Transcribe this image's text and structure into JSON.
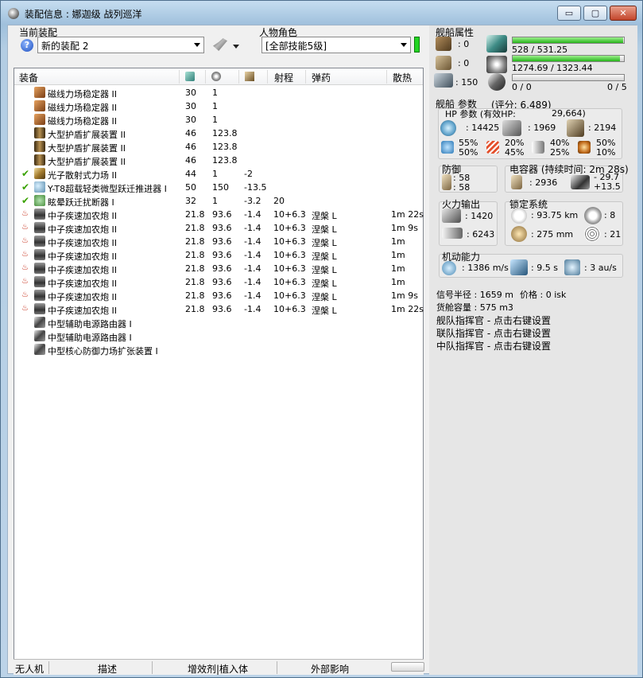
{
  "window": {
    "title": "装配信息 : 娜迦级 战列巡洋",
    "minimize_label": "▭",
    "maximize_label": "▢",
    "close_label": "✕"
  },
  "fitting": {
    "label": "当前装配",
    "selected": "新的装配 2"
  },
  "character": {
    "label": "人物角色",
    "selected": "[全部技能5级]",
    "status_color": "#22d422"
  },
  "modules_table": {
    "columns": {
      "equipment": "装备",
      "range": "射程",
      "ammo": "弹药",
      "heat": "散热"
    },
    "header_icons": [
      "cpu-icon",
      "powergrid-icon",
      "capacitor-icon"
    ],
    "rows": [
      {
        "status": "",
        "icon": "magnetic-field-stabilizer-icon",
        "name": "磁线力场稳定器 II",
        "cpu": "30",
        "pg": "1",
        "cap": "",
        "range": "",
        "ammo": "",
        "heat": ""
      },
      {
        "status": "",
        "icon": "magnetic-field-stabilizer-icon",
        "name": "磁线力场稳定器 II",
        "cpu": "30",
        "pg": "1",
        "cap": "",
        "range": "",
        "ammo": "",
        "heat": ""
      },
      {
        "status": "",
        "icon": "magnetic-field-stabilizer-icon",
        "name": "磁线力场稳定器 II",
        "cpu": "30",
        "pg": "1",
        "cap": "",
        "range": "",
        "ammo": "",
        "heat": ""
      },
      {
        "status": "",
        "icon": "shield-extender-icon",
        "name": "大型护盾扩展装置 II",
        "cpu": "46",
        "pg": "123.8",
        "cap": "",
        "range": "",
        "ammo": "",
        "heat": ""
      },
      {
        "status": "",
        "icon": "shield-extender-icon",
        "name": "大型护盾扩展装置 II",
        "cpu": "46",
        "pg": "123.8",
        "cap": "",
        "range": "",
        "ammo": "",
        "heat": ""
      },
      {
        "status": "",
        "icon": "shield-extender-icon",
        "name": "大型护盾扩展装置 II",
        "cpu": "46",
        "pg": "123.8",
        "cap": "",
        "range": "",
        "ammo": "",
        "heat": ""
      },
      {
        "status": "✔",
        "icon": "photon-scattering-field-icon",
        "name": "光子散射式力场 II",
        "cpu": "44",
        "pg": "1",
        "cap": "-2",
        "range": "",
        "ammo": "",
        "heat": ""
      },
      {
        "status": "✔",
        "icon": "microwarpdrive-icon",
        "name": "Y-T8超载轻类微型跃迁推进器 I",
        "cpu": "50",
        "pg": "150",
        "cap": "-13.5",
        "range": "",
        "ammo": "",
        "heat": ""
      },
      {
        "status": "✔",
        "icon": "warp-scrambler-icon",
        "name": "眩晕跃迁扰断器 I",
        "cpu": "32",
        "pg": "1",
        "cap": "-3.2",
        "range": "20",
        "ammo": "",
        "heat": ""
      },
      {
        "status": "heat",
        "icon": "blaster-icon",
        "name": "中子疾速加农炮 II",
        "cpu": "21.8",
        "pg": "93.6",
        "cap": "-1.4",
        "range": "10+6.3",
        "ammo": "涅槃 L",
        "heat": "1m 22s"
      },
      {
        "status": "heat",
        "icon": "blaster-icon",
        "name": "中子疾速加农炮 II",
        "cpu": "21.8",
        "pg": "93.6",
        "cap": "-1.4",
        "range": "10+6.3",
        "ammo": "涅槃 L",
        "heat": "1m 9s"
      },
      {
        "status": "heat",
        "icon": "blaster-icon",
        "name": "中子疾速加农炮 II",
        "cpu": "21.8",
        "pg": "93.6",
        "cap": "-1.4",
        "range": "10+6.3",
        "ammo": "涅槃 L",
        "heat": "1m"
      },
      {
        "status": "heat",
        "icon": "blaster-icon",
        "name": "中子疾速加农炮 II",
        "cpu": "21.8",
        "pg": "93.6",
        "cap": "-1.4",
        "range": "10+6.3",
        "ammo": "涅槃 L",
        "heat": "1m"
      },
      {
        "status": "heat",
        "icon": "blaster-icon",
        "name": "中子疾速加农炮 II",
        "cpu": "21.8",
        "pg": "93.6",
        "cap": "-1.4",
        "range": "10+6.3",
        "ammo": "涅槃 L",
        "heat": "1m"
      },
      {
        "status": "heat",
        "icon": "blaster-icon",
        "name": "中子疾速加农炮 II",
        "cpu": "21.8",
        "pg": "93.6",
        "cap": "-1.4",
        "range": "10+6.3",
        "ammo": "涅槃 L",
        "heat": "1m"
      },
      {
        "status": "heat",
        "icon": "blaster-icon",
        "name": "中子疾速加农炮 II",
        "cpu": "21.8",
        "pg": "93.6",
        "cap": "-1.4",
        "range": "10+6.3",
        "ammo": "涅槃 L",
        "heat": "1m 9s"
      },
      {
        "status": "heat",
        "icon": "blaster-icon",
        "name": "中子疾速加农炮 II",
        "cpu": "21.8",
        "pg": "93.6",
        "cap": "-1.4",
        "range": "10+6.3",
        "ammo": "涅槃 L",
        "heat": "1m 22s"
      },
      {
        "status": "",
        "icon": "rig-icon",
        "name": "中型辅助电源路由器 I",
        "cpu": "",
        "pg": "",
        "cap": "",
        "range": "",
        "ammo": "",
        "heat": ""
      },
      {
        "status": "",
        "icon": "rig-icon",
        "name": "中型辅助电源路由器 I",
        "cpu": "",
        "pg": "",
        "cap": "",
        "range": "",
        "ammo": "",
        "heat": ""
      },
      {
        "status": "",
        "icon": "rig-icon",
        "name": "中型核心防御力场扩张装置 I",
        "cpu": "",
        "pg": "",
        "cap": "",
        "range": "",
        "ammo": "",
        "heat": ""
      }
    ]
  },
  "bottom_tabs": [
    "无人机",
    "描述",
    "增效剂|植入体",
    "外部影响"
  ],
  "ship_attributes": {
    "title": "舰船属性",
    "drone_bandwidth": ": 0",
    "drone_bay": ": 0",
    "turret_value": ": 150",
    "powergrid": {
      "text": "528 / 531.25",
      "fraction": 0.994
    },
    "cpu": {
      "text": "1274.69 / 1323.44",
      "fraction": 0.963
    },
    "calibration": {
      "left": "0 / 0",
      "right": "0 / 5",
      "fraction": 0
    }
  },
  "ship_params": {
    "title": "舰船 参数",
    "score": "(评分:  6,489)",
    "hp_title": "HP 参数 (有效HP:",
    "ehp": "29,664)",
    "shield_hp": ": 14425",
    "armor_hp": ": 1969",
    "hull_hp": ": 2194",
    "resists": {
      "em": [
        "55%",
        "50%"
      ],
      "thermal": [
        "20%",
        "45%"
      ],
      "kinetic": [
        "40%",
        "25%"
      ],
      "explosive": [
        "50%",
        "10%"
      ]
    }
  },
  "defense": {
    "title": "防御",
    "v1": ": 58",
    "v2": ": 58"
  },
  "capacitor": {
    "title": "电容器 (持续时间: 2m 28s)",
    "capacity": ": 2936",
    "delta": "- 29.7",
    "regen": "+13.5"
  },
  "firepower": {
    "title": "火力输出",
    "dps": ": 1420",
    "volley": ": 6243"
  },
  "targeting": {
    "title": "锁定系统",
    "range": ": 93.75 km",
    "max_targets": ": 8",
    "scan_res": ": 275 mm",
    "sensor": ": 21"
  },
  "mobility": {
    "title": "机动能力",
    "speed": ": 1386 m/s",
    "align": ": 9.5 s",
    "warp": ": 3 au/s"
  },
  "misc": {
    "signature": "信号半径 : 1659 m",
    "price": "价格 : 0 isk",
    "cargo": "货舱容量 : 575 m3",
    "fleet_commander": "舰队指挥官 - 点击右键设置",
    "wing_commander": "联队指挥官 - 点击右键设置",
    "squad_commander": "中队指挥官 - 点击右键设置"
  }
}
